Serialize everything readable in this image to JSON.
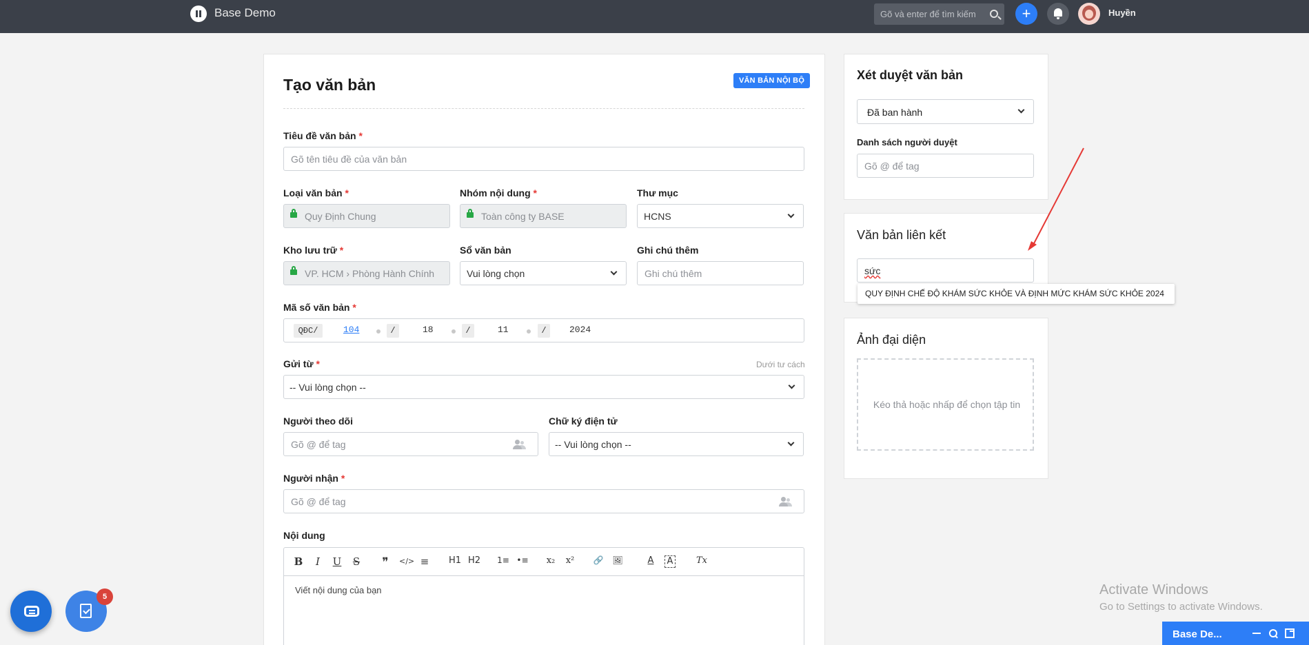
{
  "topbar": {
    "app_title": "Base Demo",
    "search_placeholder": "Gõ và enter để tìm kiếm",
    "plus_label": "+",
    "user_name": "Huyền"
  },
  "form": {
    "title": "Tạo văn bản",
    "badge": "VĂN BẢN NỘI BỘ",
    "doc_title": {
      "label": "Tiêu đề văn bản",
      "required": "*",
      "placeholder": "Gõ tên tiêu đề của văn bản"
    },
    "doc_type": {
      "label": "Loại văn bản",
      "required": "*",
      "value": "Quy Định Chung"
    },
    "content_group": {
      "label": "Nhóm nội dung",
      "required": "*",
      "value": "Toàn công ty BASE"
    },
    "folder": {
      "label": "Thư mục",
      "value": "HCNS"
    },
    "storage": {
      "label": "Kho lưu trữ",
      "required": "*",
      "value": "VP. HCM › Phòng Hành Chính"
    },
    "doc_book": {
      "label": "Sổ văn bản",
      "value": "Vui lòng chọn"
    },
    "note": {
      "label": "Ghi chú thêm",
      "placeholder": "Ghi chú thêm"
    },
    "doc_number": {
      "label": "Mã số văn bản",
      "required": "*",
      "prefix": "QĐC/",
      "number": "104",
      "sep1": "/",
      "day": "18",
      "sep2": "/",
      "month": "11",
      "sep3": "/",
      "year": "2024"
    },
    "send_from": {
      "label": "Gửi từ",
      "required": "*",
      "hint": "Dưới tư cách",
      "value": "-- Vui lòng chọn --"
    },
    "followers": {
      "label": "Người theo dõi",
      "placeholder": "Gõ @ để tag"
    },
    "e_signature": {
      "label": "Chữ ký điện tử",
      "value": "-- Vui lòng chọn --"
    },
    "recipients": {
      "label": "Người nhận",
      "required": "*",
      "placeholder": "Gõ @ để tag"
    },
    "content": {
      "label": "Nội dung",
      "placeholder": "Viết nội dung của bạn",
      "toolbar": [
        "B",
        "I",
        "U",
        "S",
        "❞",
        "</>",
        "≡",
        "H1",
        "H2",
        "1≡",
        "•≡",
        "x₂",
        "x²",
        "🔗",
        "🖼",
        "A",
        "A",
        "Tx"
      ]
    }
  },
  "review": {
    "title": "Xét duyệt văn bản",
    "status_value": "Đã ban hành",
    "reviewers_label": "Danh sách người duyệt",
    "reviewers_placeholder": "Gõ @ để tag"
  },
  "linked": {
    "title": "Văn bản liên kết",
    "input_value": "sức",
    "suggestion": "QUY ĐỊNH CHẾ ĐỘ KHÁM SỨC KHỎE VÀ ĐỊNH MỨC KHÁM SỨC KHỎE 2024"
  },
  "avatar_card": {
    "title": "Ảnh đại diện",
    "dropzone_text": "Kéo thả hoặc nhấp để chọn tập tin"
  },
  "floating": {
    "task_badge": "5"
  },
  "watermark": {
    "line1": "Activate Windows",
    "line2": "Go to Settings to activate Windows."
  },
  "minibar": {
    "title": "Base De..."
  },
  "colors": {
    "accent": "#2d7ef7",
    "topbar": "#3b4049",
    "required": "#e53935",
    "arrow": "#e53935"
  }
}
